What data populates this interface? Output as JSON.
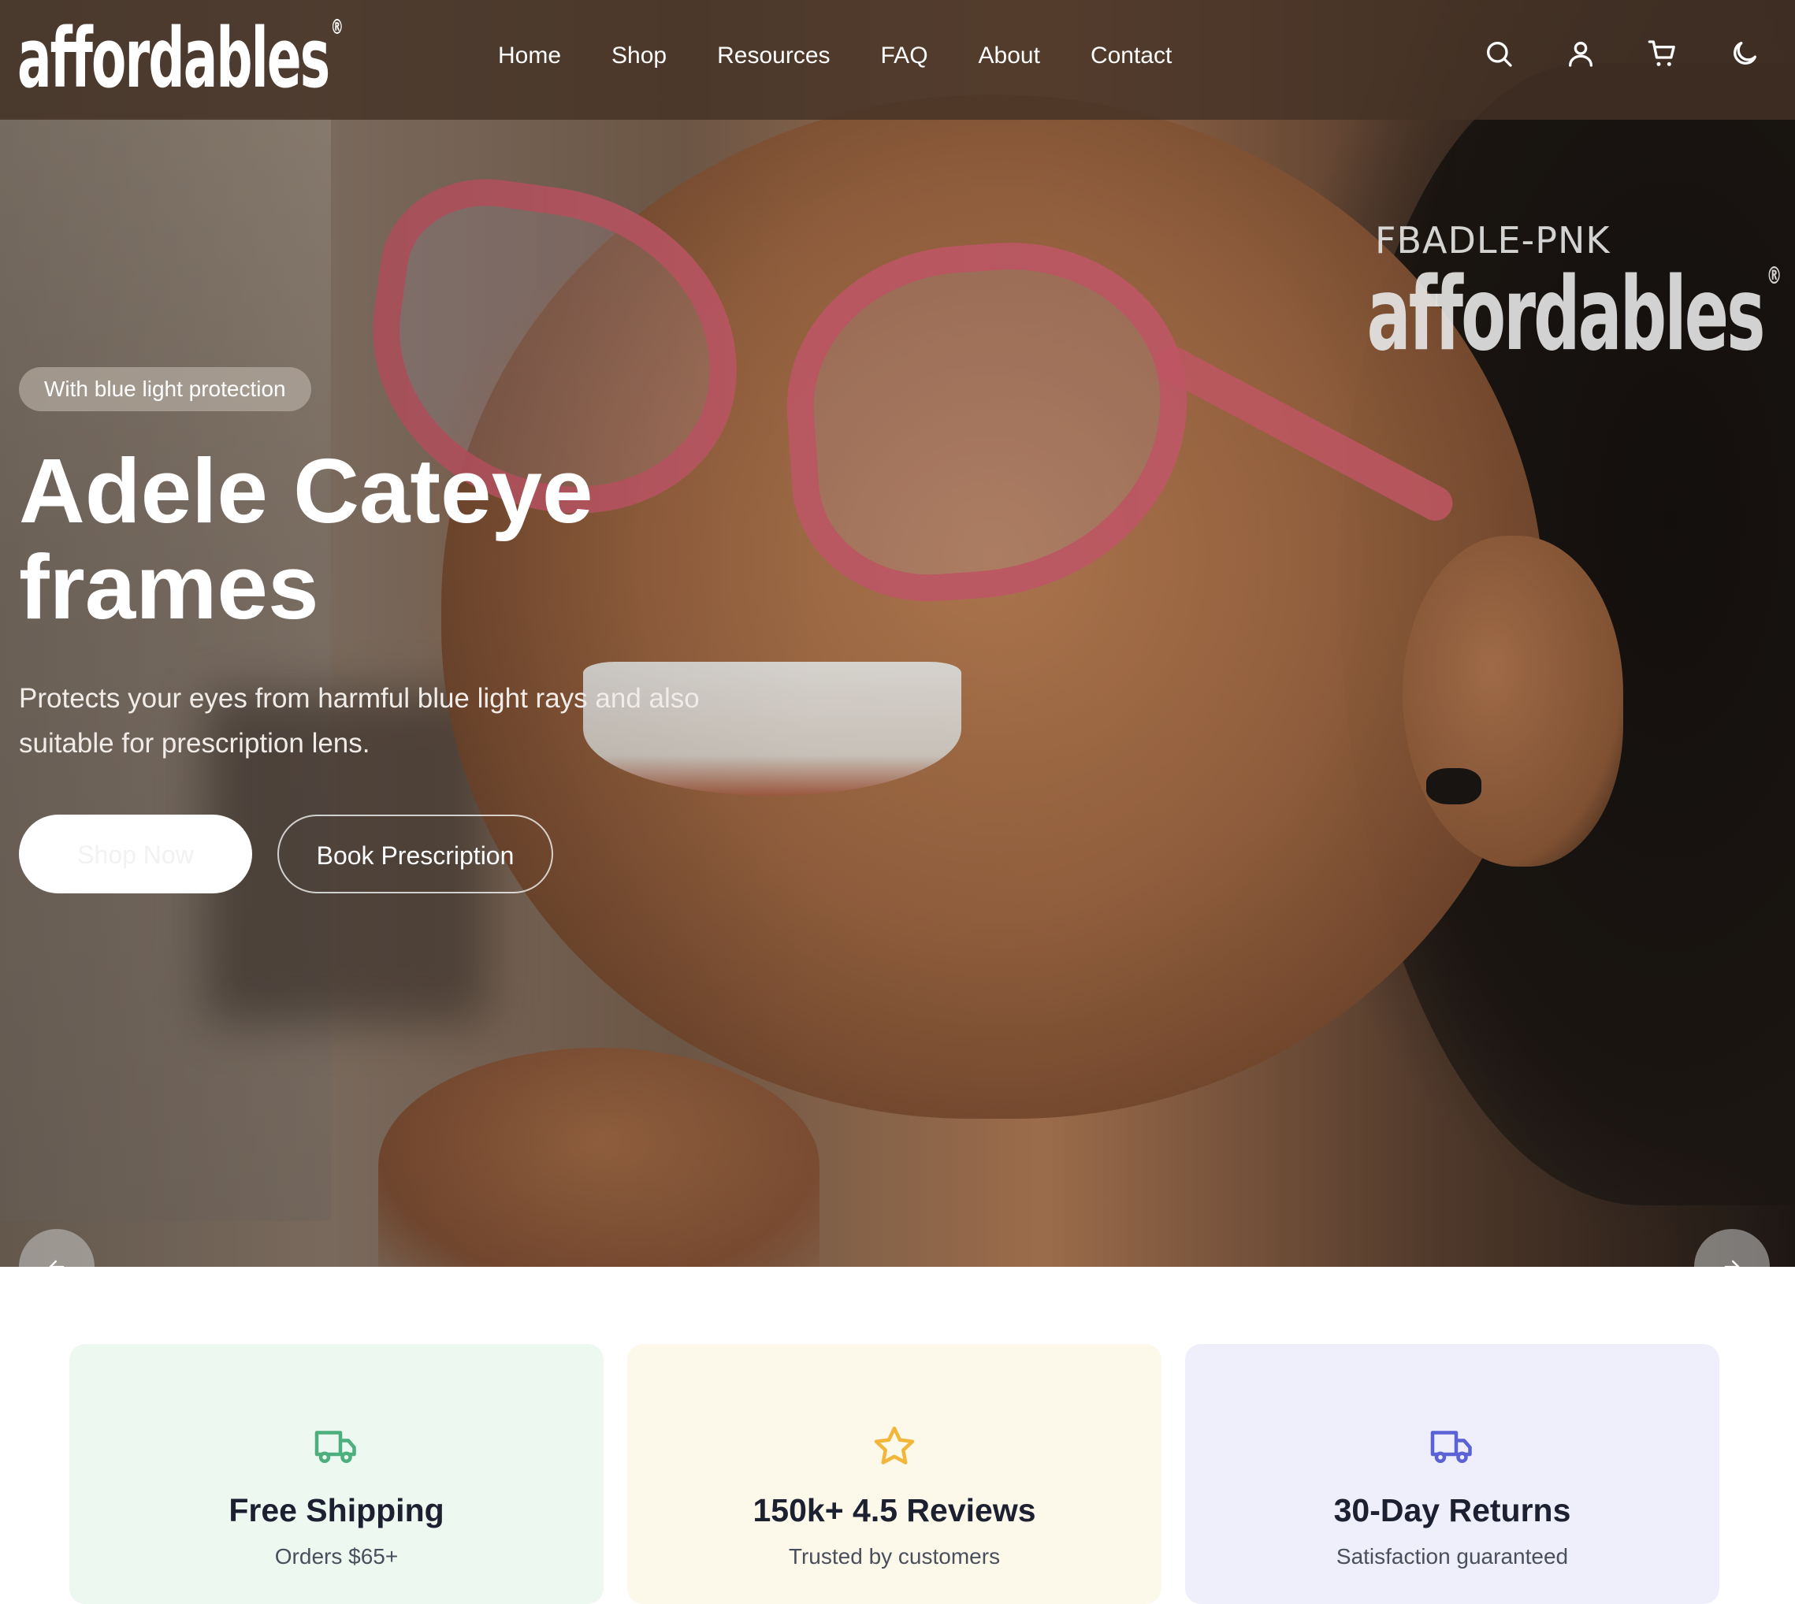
{
  "brand": {
    "logo_text": "affordables",
    "registered_mark": "®"
  },
  "nav": {
    "links": [
      "Home",
      "Shop",
      "Resources",
      "FAQ",
      "About",
      "Contact"
    ],
    "icons": [
      "search-icon",
      "user-icon",
      "cart-icon",
      "dark-mode-moon-icon"
    ]
  },
  "hero": {
    "badge": "With blue light protection",
    "title_line1": "Adele Cateye",
    "title_line2": "frames",
    "description": "Protects your eyes from harmful blue light rays and also suitable for prescription lens.",
    "primary_button": "Shop Now",
    "secondary_button": "Book Prescription",
    "watermark_sku": "FBADLE-PNK",
    "watermark_logo": "affordables"
  },
  "features": [
    {
      "title": "Free Shipping",
      "subtitle": "Orders $65+",
      "icon": "truck-icon",
      "color": "#4caf7d"
    },
    {
      "title": "150k+ 4.5 Reviews",
      "subtitle": "Trusted by customers",
      "icon": "star-icon",
      "color": "#f2b63a"
    },
    {
      "title": "30-Day Returns",
      "subtitle": "Satisfaction guaranteed",
      "icon": "truck-icon",
      "color": "#5b62d6"
    }
  ]
}
